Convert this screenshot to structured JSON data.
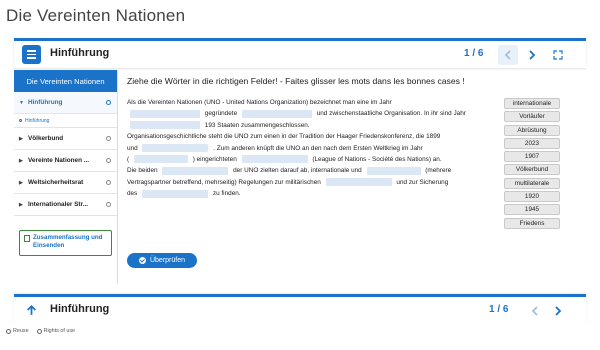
{
  "page_title": "Die Vereinten Nationen",
  "topbar": {
    "title": "Hinführung",
    "pager": "1 / 6"
  },
  "sidebar": {
    "header": "Die Vereinten Nationen",
    "items": [
      {
        "label": "Hinführung"
      },
      {
        "label": "Hinführung"
      },
      {
        "label": "Völkerbund"
      },
      {
        "label": "Vereinte Nationen ..."
      },
      {
        "label": "Weltsicherheitsrat"
      },
      {
        "label": "Internationaler Str..."
      }
    ],
    "summary_button": "Zusammenfassung und Einsenden"
  },
  "exercise": {
    "instruction": "Ziehe die Wörter in die richtigen Felder! - Faites glisser les mots dans les bonnes cases !",
    "t1": "Als die Vereinten Nationen (UNO - United Nations Organization) bezeichnet man eine im Jahr",
    "t2": "gegründete",
    "t3": "und zwischenstaatliche Organisation. In ihr sind Jahr",
    "t4": "193 Staaten zusammengeschlossen.",
    "t5": "Organisationsgeschichtliche steht die UNO zum einen in der Tradition der Haager Friedenskonferenz, die 1899",
    "t6": "und",
    "t7": ". Zum anderen knüpft die UNO an den nach dem Ersten Weltkrieg im Jahr",
    "t8": "(",
    "t9": ") eingerichteten",
    "t10": "(League of Nations - Société des Nations) an.",
    "t11": "Die beiden",
    "t12": "der UNO zielten darauf ab, internationale und",
    "t13": "(mehrere",
    "t14": "Vertragspartner betreffend, mehrseitig) Regelungen zur militärischen",
    "t15": "und zur Sicherung",
    "t16": "des",
    "t17": "zu finden.",
    "words": [
      "internationale",
      "Vorläufer",
      "Abrüstung",
      "2023",
      "1907",
      "Völkerbund",
      "multilaterale",
      "1920",
      "1945",
      "Friedens"
    ],
    "check_button": "Überprüfen"
  },
  "bottombar": {
    "title": "Hinführung",
    "pager": "1 / 6"
  },
  "footer": {
    "reuse": "Reuse",
    "rights": "Rights of use"
  },
  "colors": {
    "accent": "#1a73c9",
    "blank": "#dbe7f4",
    "word_chip": "#e8e8e8"
  }
}
